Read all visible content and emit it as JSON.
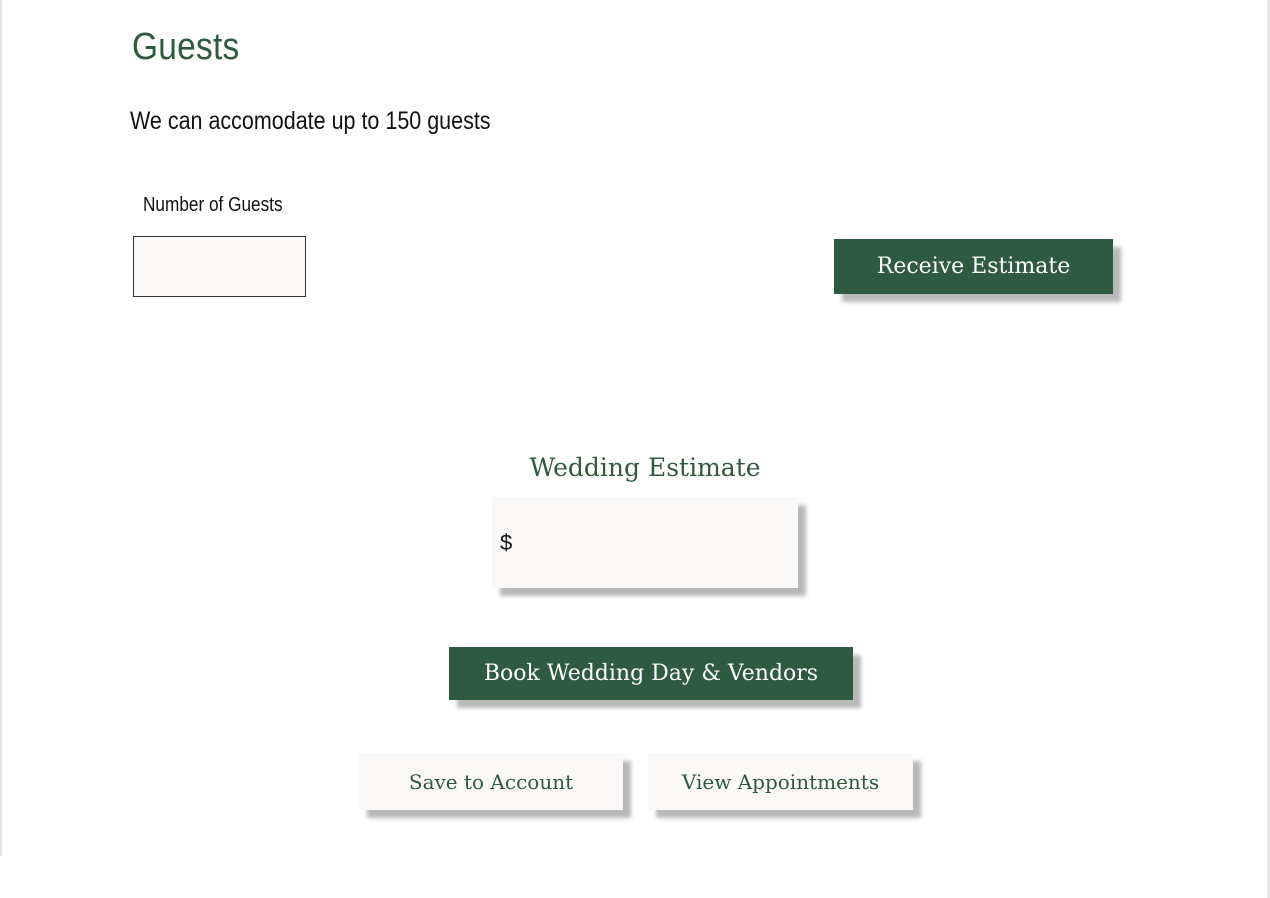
{
  "section": {
    "title": "Guests",
    "capacity_text": "We can accomodate up to 150 guests"
  },
  "guests": {
    "label": "Number of Guests",
    "value": ""
  },
  "actions": {
    "receive_estimate": "Receive Estimate",
    "book": "Book Wedding Day & Vendors",
    "save": "Save to Account",
    "view": "View Appointments"
  },
  "estimate": {
    "title": "Wedding Estimate",
    "currency_symbol": "$",
    "amount": ""
  },
  "colors": {
    "brand_green": "#2e5a3f",
    "surface": "#faf9f7"
  }
}
